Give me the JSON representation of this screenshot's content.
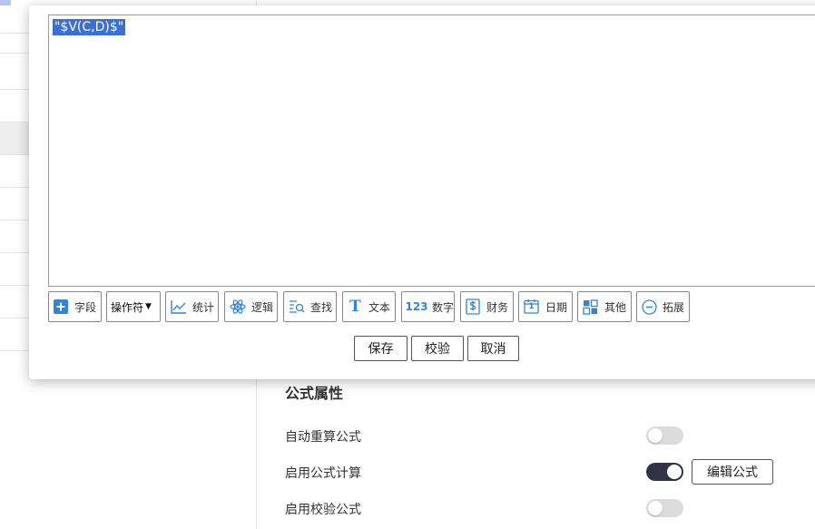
{
  "editor": {
    "formula_text": "\"$V(C,D)$\""
  },
  "toolbar": {
    "items": [
      {
        "label": "字段",
        "icon": "plus-square-icon"
      },
      {
        "label": "操作符",
        "icon": "dropdown-caret-icon"
      },
      {
        "label": "统计",
        "icon": "line-chart-icon"
      },
      {
        "label": "逻辑",
        "icon": "atom-icon"
      },
      {
        "label": "查找",
        "icon": "search-list-icon"
      },
      {
        "label": "文本",
        "icon": "text-t-icon"
      },
      {
        "label": "数字",
        "icon": "number-123-icon"
      },
      {
        "label": "财务",
        "icon": "dollar-doc-icon"
      },
      {
        "label": "日期",
        "icon": "calendar-icon"
      },
      {
        "label": "其他",
        "icon": "grid-icon"
      },
      {
        "label": "拓展",
        "icon": "ellipsis-circle-icon"
      }
    ],
    "icon_glyphs": {
      "number": "123",
      "text": "T",
      "calendar": "1"
    }
  },
  "actions": {
    "save": "保存",
    "validate": "校验",
    "cancel": "取消"
  },
  "properties": {
    "title": "公式属性",
    "rows": [
      {
        "label": "自动重算公式",
        "enabled": false
      },
      {
        "label": "启用公式计算",
        "enabled": true,
        "button": "编辑公式"
      },
      {
        "label": "启用校验公式",
        "enabled": false
      }
    ]
  },
  "colors": {
    "accent": "#3b6fd6",
    "icon_blue": "#2f86d6",
    "switch_on": "#303545",
    "switch_off": "#dcdcdc"
  }
}
